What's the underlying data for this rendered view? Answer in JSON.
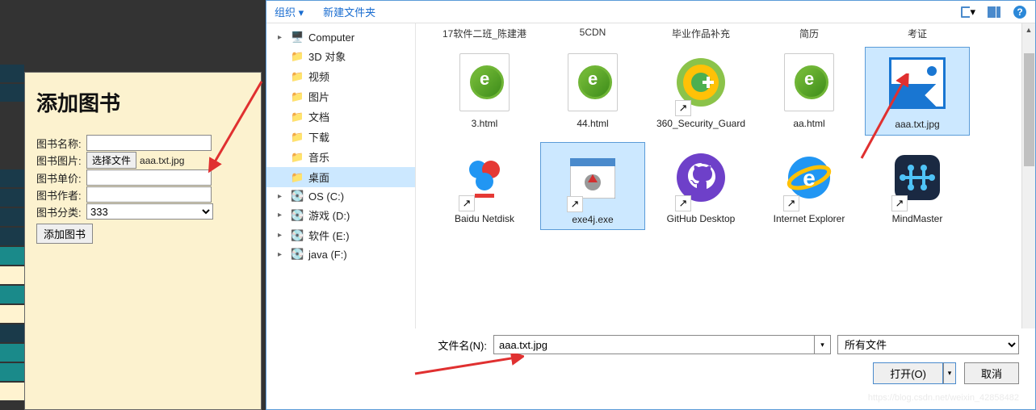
{
  "form": {
    "title": "添加图书",
    "labels": {
      "name": "图书名称:",
      "pic": "图书图片:",
      "price": "图书单价:",
      "author": "图书作者:",
      "category": "图书分类:"
    },
    "file_button": "选择文件",
    "file_name": "aaa.txt.jpg",
    "category_value": "333",
    "submit": "添加图书"
  },
  "toolbar": {
    "organize": "组织 ▾",
    "new_folder": "新建文件夹"
  },
  "tree": {
    "computer": "Computer",
    "items": [
      "3D 对象",
      "视频",
      "图片",
      "文档",
      "下载",
      "音乐",
      "桌面",
      "OS (C:)",
      "游戏 (D:)",
      "软件 (E:)",
      "java (F:)"
    ]
  },
  "headers": [
    "17软件二班_陈建港",
    "5CDN",
    "毕业作品补充",
    "简历",
    "考证"
  ],
  "files": {
    "row1": [
      {
        "name": "3.html",
        "type": "e"
      },
      {
        "name": "44.html",
        "type": "e"
      },
      {
        "name": "360_Security_Guard",
        "type": "360"
      },
      {
        "name": "aa.html",
        "type": "e"
      },
      {
        "name": "aaa.txt.jpg",
        "type": "pic"
      }
    ],
    "row2": [
      {
        "name": "Baidu Netdisk",
        "type": "baidu"
      },
      {
        "name": "exe4j.exe",
        "type": "exe4j"
      },
      {
        "name": "GitHub Desktop",
        "type": "github"
      },
      {
        "name": "Internet Explorer",
        "type": "ie"
      },
      {
        "name": "MindMaster",
        "type": "mind"
      }
    ]
  },
  "footer": {
    "name_label": "文件名(N):",
    "name_value": "aaa.txt.jpg",
    "type_value": "所有文件",
    "open": "打开(O)",
    "cancel": "取消"
  },
  "watermark": "https://blog.csdn.net/weixin_42858482"
}
